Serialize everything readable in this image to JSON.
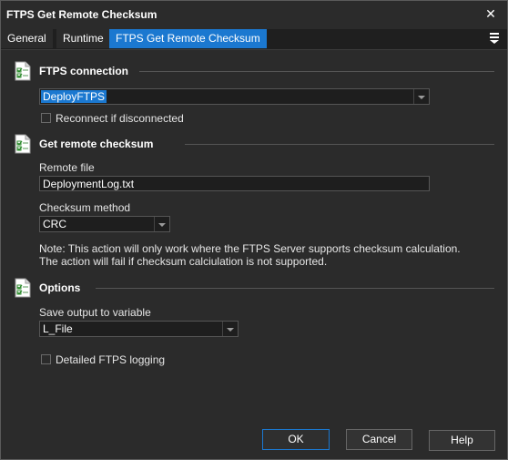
{
  "window": {
    "title": "FTPS Get Remote Checksum",
    "close_glyph": "✕"
  },
  "tabs": [
    {
      "label": "General"
    },
    {
      "label": "Runtime"
    },
    {
      "label": "FTPS Get Remote Checksum"
    }
  ],
  "sections": {
    "connection": {
      "title": "FTPS connection",
      "select_value": "DeployFTPS",
      "reconnect_label": "Reconnect if disconnected",
      "reconnect_checked": false
    },
    "checksum": {
      "title": "Get remote checksum",
      "remote_file_label": "Remote file",
      "remote_file_value": "DeploymentLog.txt",
      "method_label": "Checksum method",
      "method_value": "CRC",
      "note_line1": "Note: This action will only work where the FTPS Server supports checksum calculation.",
      "note_line2": "The action will fail if checksum calciulation is not supported."
    },
    "options": {
      "title": "Options",
      "save_label": "Save output to variable",
      "save_value": "L_File",
      "logging_label": "Detailed FTPS logging",
      "logging_checked": false
    }
  },
  "buttons": {
    "ok": "OK",
    "cancel": "Cancel",
    "help": "Help"
  },
  "colors": {
    "accent": "#1b78d0",
    "background": "#2b2b2b"
  }
}
